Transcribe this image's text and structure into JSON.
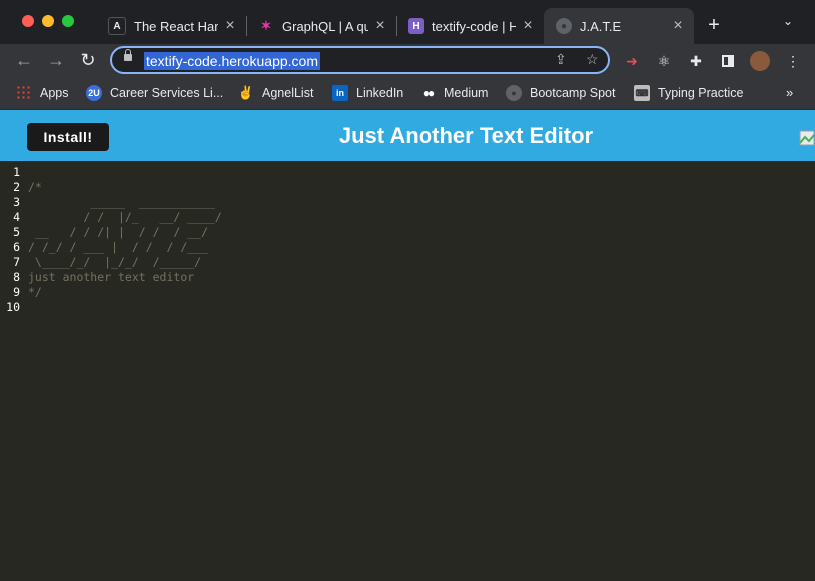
{
  "browser": {
    "tabs": [
      {
        "title": "The React Hand",
        "icon": "react-icon"
      },
      {
        "title": "GraphQL | A qu",
        "icon": "graphql-icon"
      },
      {
        "title": "textify-code | H",
        "icon": "heroku-icon"
      },
      {
        "title": "J.A.T.E",
        "icon": "globe-icon",
        "active": true
      }
    ],
    "new_tab": "+",
    "url": "textify-code.herokuapp.com",
    "bookmarks": [
      {
        "label": "Apps",
        "icon": "apps-grid-icon"
      },
      {
        "label": "Career Services Li...",
        "icon": "2u-icon"
      },
      {
        "label": "AgnelList",
        "icon": "peace-hand-icon"
      },
      {
        "label": "LinkedIn",
        "icon": "linkedin-icon"
      },
      {
        "label": "Medium",
        "icon": "medium-icon"
      },
      {
        "label": "Bootcamp Spot",
        "icon": "globe-icon"
      },
      {
        "label": "Typing Practice",
        "icon": "keyboard-icon"
      }
    ],
    "bookmarks_overflow": "»"
  },
  "app": {
    "install_label": "Install!",
    "title": "Just Another Text Editor"
  },
  "editor": {
    "lines": [
      {
        "n": "1",
        "text": ""
      },
      {
        "n": "2",
        "text": "/*"
      },
      {
        "n": "3",
        "text": "         _____  ___________"
      },
      {
        "n": "4",
        "text": "        / /  |/_   __/ ____/"
      },
      {
        "n": "5",
        "text": " __   / / /| |  / /  / __/"
      },
      {
        "n": "6",
        "text": "/ /_/ / ___ |  / /  / /___"
      },
      {
        "n": "7",
        "text": " \\____/_/  |_/_/  /_____/"
      },
      {
        "n": "8",
        "text": "just another text editor"
      },
      {
        "n": "9",
        "text": "*/"
      },
      {
        "n": "10",
        "text": ""
      }
    ]
  },
  "colors": {
    "header": "#31a9e1",
    "editor_bg": "#272822",
    "comment": "#75715e"
  }
}
